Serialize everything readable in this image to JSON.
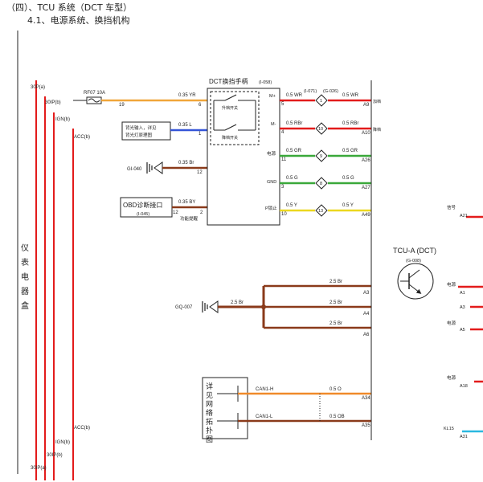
{
  "header": {
    "section_title": "（四）、TCU 系统（DCT 车型）",
    "subsection_title": "4.1、电源系统、换挡机构"
  },
  "left_box": {
    "vertical_label": [
      "仪",
      "表",
      "电",
      "器",
      "盒"
    ],
    "rails": {
      "top": [
        "30P(a)",
        "30IP(b)",
        "IGN(b)",
        "ACC(b)"
      ],
      "bottom": [
        "ACC(b)",
        "IGN(b)",
        "30IP(b)",
        "30IP(a)"
      ]
    }
  },
  "fuse": {
    "name": "RF07 10A",
    "out_pin": "19"
  },
  "shifter": {
    "title": "DCT换挡手柄",
    "code": "(I-058)",
    "switch_upshift": "升档开关",
    "switch_downshift": "降档开关",
    "pins_left": [
      "6",
      "1",
      "12",
      "2"
    ],
    "pins_right": [
      "5",
      "4",
      "11",
      "3",
      "10"
    ],
    "pin_labels_right": [
      "M+",
      "M-",
      "电源",
      "GND",
      "P锁止"
    ],
    "function_prompt": "功能提醒"
  },
  "connectors": {
    "inline1": "(I-071)",
    "inline2": "(G-026)"
  },
  "wires_left": [
    {
      "label": "0.35 YR"
    },
    {
      "label": "0.35 L"
    },
    {
      "label": "0.35 Br"
    },
    {
      "label": "0.35 BY"
    }
  ],
  "wires_right": [
    {
      "in": "0.5 WR",
      "pin": "1",
      "out": "0.5 WR",
      "term": "A9",
      "note": "加档"
    },
    {
      "in": "0.5 RBr",
      "pin": "10",
      "out": "0.5 RBr",
      "term": "A10",
      "note": "降档"
    },
    {
      "in": "0.5 GR",
      "pin": "9",
      "out": "0.5 GR",
      "term": "A26",
      "note": ""
    },
    {
      "in": "0.5 G",
      "pin": "8",
      "out": "0.5 G",
      "term": "A27",
      "note": ""
    },
    {
      "in": "0.5 Y",
      "pin": "13",
      "out": "0.5 Y",
      "term": "A49",
      "note": ""
    }
  ],
  "lamp_box": {
    "text": [
      "背光输入，详见",
      "背光灯原理图"
    ]
  },
  "ground_shifter": "GI-040",
  "obd": {
    "title": "OBD诊断接口",
    "code": "(I-045)",
    "pin": "12"
  },
  "ground_tcu": {
    "name": "GQ-007",
    "trunk_label": "2.5 Br",
    "branches": [
      {
        "label": "2.5 Br",
        "term": "A3"
      },
      {
        "label": "2.5 Br",
        "term": "A4"
      },
      {
        "label": "2.5 Br",
        "term": "A6"
      }
    ]
  },
  "can_box": {
    "text": [
      "详",
      "见",
      "网",
      "络",
      "拓",
      "扑",
      "图"
    ],
    "lines": [
      {
        "name": "CAN1-H",
        "size": "0.5 O",
        "term": "A34"
      },
      {
        "name": "CAN1-L",
        "size": "0.5 OB",
        "term": "A35"
      }
    ]
  },
  "tcu": {
    "name": "TCU-A (DCT)",
    "code": "(G-008)"
  },
  "tcu_right_pins": [
    {
      "label": "信号",
      "term": "A21"
    },
    {
      "label": "电源",
      "term": "A1"
    },
    {
      "label": "",
      "term": "A3"
    },
    {
      "label": "电源",
      "term": "A4"
    },
    {
      "label": "",
      "term": "A5"
    },
    {
      "label": "电源",
      "term": "A18"
    },
    {
      "label": "KL15",
      "term": "A31"
    }
  ],
  "colors": {
    "power_red": "#e31b1b",
    "yellow_red": "#f0a63a",
    "blue": "#3555d8",
    "brown": "#8a3a1a",
    "green": "#3aa83a",
    "yellow": "#ecd820",
    "orange": "#f08a2a",
    "cyan": "#2ab8e0"
  }
}
